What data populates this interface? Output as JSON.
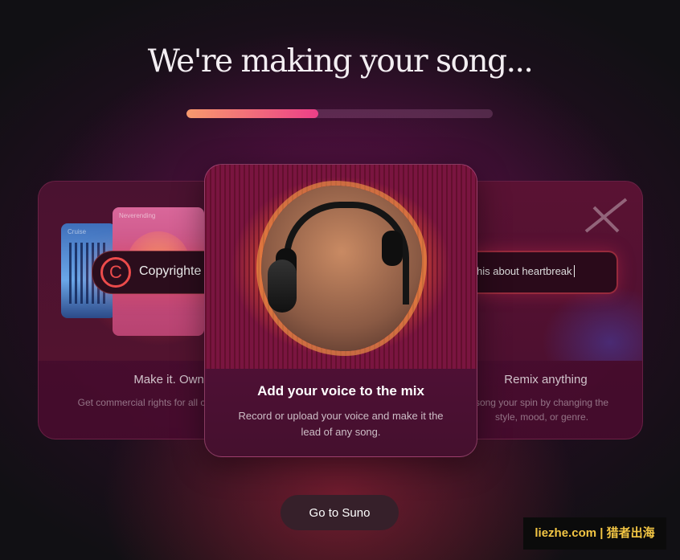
{
  "header": {
    "title": "We're making your song...",
    "progress_fraction": 0.43,
    "progress_colors": [
      "#f79a6d",
      "#ec3f88"
    ]
  },
  "cards": {
    "left": {
      "title": "Make it. Own it.",
      "description": "Get commercial rights for all creations.",
      "mini_label_a": "Cruise",
      "mini_label_b": "Neverending",
      "pill_text": "Copyrighte"
    },
    "center": {
      "title": "Add your voice to the mix",
      "description": "Record or upload your voice and make it the lead of any song."
    },
    "right": {
      "title": "Remix anything",
      "description": "song your spin by changing the style, mood, or genre.",
      "prompt_text": "his about heartbreak"
    }
  },
  "actions": {
    "go_label": "Go to Suno"
  },
  "watermark": {
    "text": "liezhe.com | 猎者出海"
  },
  "colors": {
    "background": "#111014",
    "accent_pink": "#ec3f88",
    "accent_orange": "#f79a6d",
    "copyright_red": "#ec4b4b",
    "watermark_yellow": "#f3c644"
  }
}
